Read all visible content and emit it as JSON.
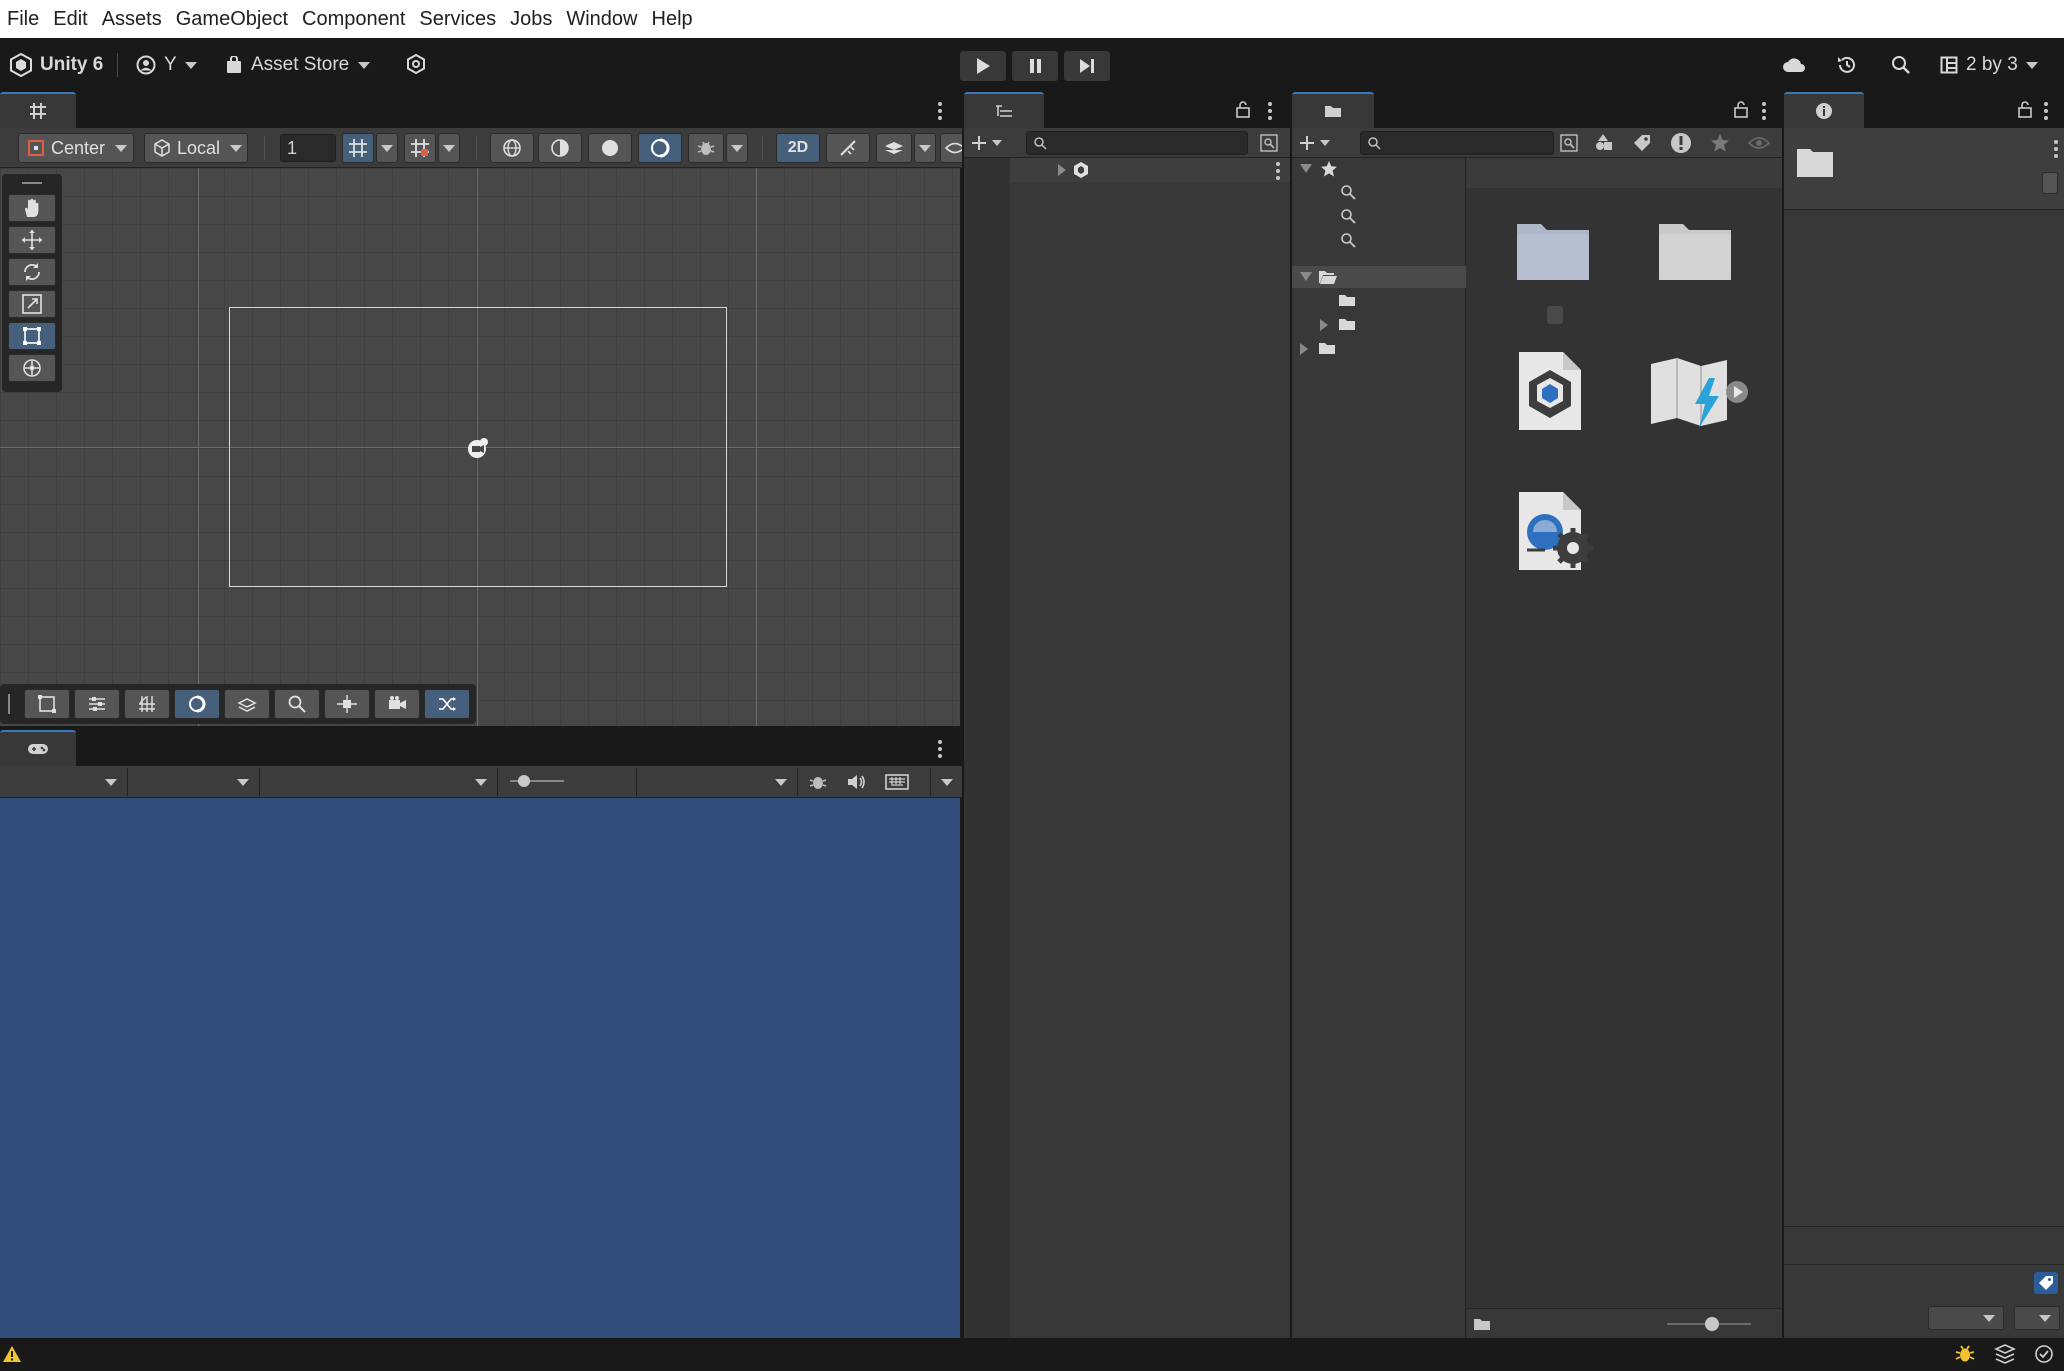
{
  "menu": [
    "File",
    "Edit",
    "Assets",
    "GameObject",
    "Component",
    "Services",
    "Jobs",
    "Window",
    "Help"
  ],
  "toolbar": {
    "product": "Unity 6",
    "account": "Y",
    "asset_store": "Asset Store",
    "layout": "2 by 3"
  },
  "scene_toolbar": {
    "pivot": "Center",
    "space": "Local",
    "grid_value": "1",
    "mode_2d": "2D"
  },
  "colors": {
    "game_view_background": "#314d79",
    "accent": "#3a79bb",
    "panel": "#383838",
    "scene_grid": "#444444"
  },
  "icons": {
    "scene_tools": [
      "hand-icon",
      "move-icon",
      "rotate-icon",
      "scale-icon",
      "rect-tool-icon",
      "transform-icon"
    ],
    "overlay_tools": [
      "rect-icon",
      "align-icon",
      "grid-icon",
      "circle-icon",
      "snap-icon",
      "search-icon",
      "pivot-icon",
      "camera-icon",
      "shuffle-icon"
    ]
  }
}
